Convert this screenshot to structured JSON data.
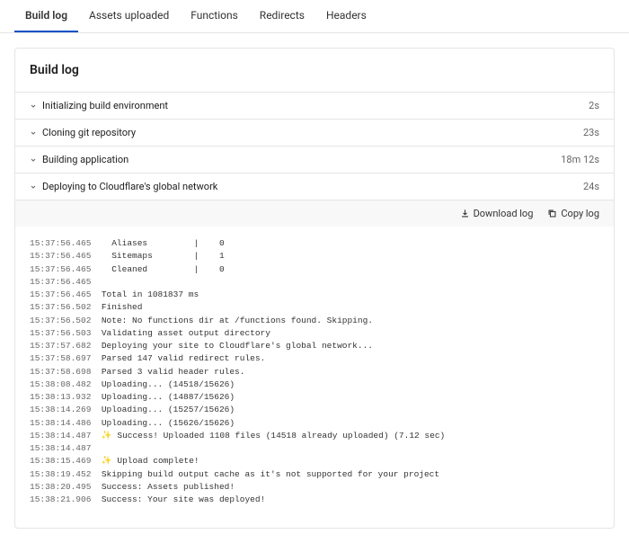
{
  "tabs": [
    {
      "label": "Build log",
      "active": true
    },
    {
      "label": "Assets uploaded",
      "active": false
    },
    {
      "label": "Functions",
      "active": false
    },
    {
      "label": "Redirects",
      "active": false
    },
    {
      "label": "Headers",
      "active": false
    }
  ],
  "panel": {
    "title": "Build log",
    "steps": [
      {
        "label": "Initializing build environment",
        "time": "2s"
      },
      {
        "label": "Cloning git repository",
        "time": "23s"
      },
      {
        "label": "Building application",
        "time": "18m 12s"
      },
      {
        "label": "Deploying to Cloudflare's global network",
        "time": "24s"
      }
    ],
    "actions": {
      "download": "Download log",
      "copy": "Copy log"
    }
  },
  "log": [
    {
      "ts": "15:37:56.465",
      "text": "  Aliases         |    0"
    },
    {
      "ts": "15:37:56.465",
      "text": "  Sitemaps        |    1"
    },
    {
      "ts": "15:37:56.465",
      "text": "  Cleaned         |    0"
    },
    {
      "ts": "15:37:56.465",
      "text": ""
    },
    {
      "ts": "15:37:56.465",
      "text": "Total in 1081837 ms"
    },
    {
      "ts": "15:37:56.502",
      "text": "Finished"
    },
    {
      "ts": "15:37:56.502",
      "text": "Note: No functions dir at /functions found. Skipping."
    },
    {
      "ts": "15:37:56.503",
      "text": "Validating asset output directory"
    },
    {
      "ts": "15:37:57.682",
      "text": "Deploying your site to Cloudflare's global network..."
    },
    {
      "ts": "15:37:58.697",
      "text": "Parsed 147 valid redirect rules."
    },
    {
      "ts": "15:37:58.698",
      "text": "Parsed 3 valid header rules."
    },
    {
      "ts": "15:38:08.482",
      "text": "Uploading... (14518/15626)"
    },
    {
      "ts": "15:38:13.932",
      "text": "Uploading... (14887/15626)"
    },
    {
      "ts": "15:38:14.269",
      "text": "Uploading... (15257/15626)"
    },
    {
      "ts": "15:38:14.486",
      "text": "Uploading... (15626/15626)"
    },
    {
      "ts": "15:38:14.487",
      "emoji": "✨",
      "text": " Success! Uploaded 1108 files (14518 already uploaded) (7.12 sec)"
    },
    {
      "ts": "15:38:14.487",
      "text": ""
    },
    {
      "ts": "15:38:15.469",
      "emoji": "✨",
      "text": " Upload complete!"
    },
    {
      "ts": "15:38:19.452",
      "text": "Skipping build output cache as it's not supported for your project"
    },
    {
      "ts": "15:38:20.495",
      "text": "Success: Assets published!"
    },
    {
      "ts": "15:38:21.906",
      "text": "Success: Your site was deployed!"
    }
  ]
}
